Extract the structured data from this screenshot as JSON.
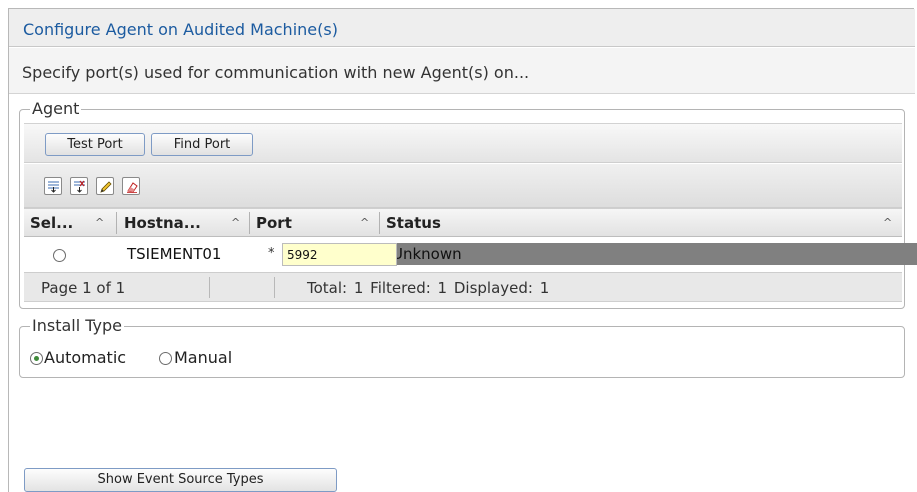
{
  "dialog": {
    "title": "Configure Agent on Audited Machine(s)",
    "subtitle": "Specify port(s) used for communication with new Agent(s) on..."
  },
  "agent": {
    "legend": "Agent",
    "buttons": {
      "test_port": "Test Port",
      "find_port": "Find Port"
    },
    "toolbar_icons": [
      "select-all-icon",
      "deselect-all-icon",
      "edit-icon",
      "clear-icon"
    ],
    "columns": [
      {
        "label": "Sel...",
        "sort": "^"
      },
      {
        "label": "Hostna...",
        "sort": "^"
      },
      {
        "label": "Port",
        "sort": "^"
      },
      {
        "label": "Status",
        "sort": "^"
      }
    ],
    "rows": [
      {
        "selected": false,
        "hostname": "TSIEMENT01",
        "required_mark": "*",
        "port": "5992",
        "status": "Unknown"
      }
    ],
    "footer": {
      "page": "Page 1 of 1",
      "stats": "Total: 1  Filtered: 1  Displayed: 1"
    }
  },
  "install_type": {
    "legend": "Install Type",
    "options": [
      {
        "label": "Automatic",
        "selected": true
      },
      {
        "label": "Manual",
        "selected": false
      }
    ]
  },
  "show_event_source_types": "Show Event Source Types",
  "colors": {
    "title": "#1c5ba0",
    "status_cell_bg": "#808080",
    "port_input_bg": "#ffffcc",
    "button_border": "#7e9bc5",
    "radio_selected": "#3f8a3a"
  }
}
